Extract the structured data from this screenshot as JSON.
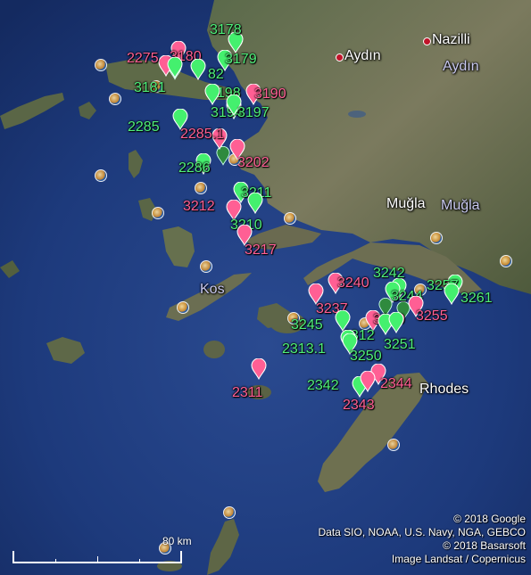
{
  "places": [
    {
      "name": "Aydın",
      "style": "normal",
      "dot": true
    },
    {
      "name": "Aydın",
      "style": "dim",
      "dot": false
    },
    {
      "name": "Nazilli",
      "style": "normal",
      "dot": true
    },
    {
      "name": "Muğla",
      "style": "normal",
      "dot": false
    },
    {
      "name": "Muğla",
      "style": "dim",
      "dot": false
    },
    {
      "name": "Kos",
      "style": "dim",
      "dot": false
    },
    {
      "name": "Rhodes",
      "style": "normal",
      "dot": false
    }
  ],
  "markers": [
    {
      "label": "2275",
      "color": "pink"
    },
    {
      "label": "3180",
      "color": "pink"
    },
    {
      "label": "3178",
      "color": "green"
    },
    {
      "label": "3179",
      "color": "green"
    },
    {
      "label": "3181",
      "color": "green"
    },
    {
      "label": "82",
      "color": "green"
    },
    {
      "label": "3198",
      "color": "green"
    },
    {
      "label": "3190",
      "color": "pink"
    },
    {
      "label": "3194",
      "color": "green"
    },
    {
      "label": "3197",
      "color": "green"
    },
    {
      "label": "2285",
      "color": "green"
    },
    {
      "label": "2285.1",
      "color": "pink"
    },
    {
      "label": "3202",
      "color": "pink"
    },
    {
      "label": "2286",
      "color": "green"
    },
    {
      "label": "3211",
      "color": "green"
    },
    {
      "label": "3212",
      "color": "pink"
    },
    {
      "label": "3210",
      "color": "green"
    },
    {
      "label": "3217",
      "color": "pink"
    },
    {
      "label": "3240",
      "color": "pink"
    },
    {
      "label": "3242",
      "color": "green"
    },
    {
      "label": "3257",
      "color": "green"
    },
    {
      "label": "3261",
      "color": "green"
    },
    {
      "label": "3237",
      "color": "pink"
    },
    {
      "label": "3244",
      "color": "green"
    },
    {
      "label": "3249",
      "color": "pink"
    },
    {
      "label": "3255",
      "color": "pink"
    },
    {
      "label": "3245",
      "color": "green"
    },
    {
      "label": "2312",
      "color": "green"
    },
    {
      "label": "3251",
      "color": "green"
    },
    {
      "label": "2313.1",
      "color": "green"
    },
    {
      "label": "3250",
      "color": "green"
    },
    {
      "label": "2311",
      "color": "pink"
    },
    {
      "label": "2342",
      "color": "green"
    },
    {
      "label": "2344",
      "color": "pink"
    },
    {
      "label": "2343",
      "color": "pink"
    }
  ],
  "colors": {
    "green": "#44f06e",
    "pink": "#ff5f94",
    "darkgreen": "#2f8a3e"
  },
  "scale": {
    "label": "80 km"
  },
  "attribution": [
    "© 2018 Google",
    "Data SIO, NOAA, U.S. Navy, NGA, GEBCO",
    "© 2018 Basarsoft",
    "Image Landsat / Copernicus"
  ]
}
